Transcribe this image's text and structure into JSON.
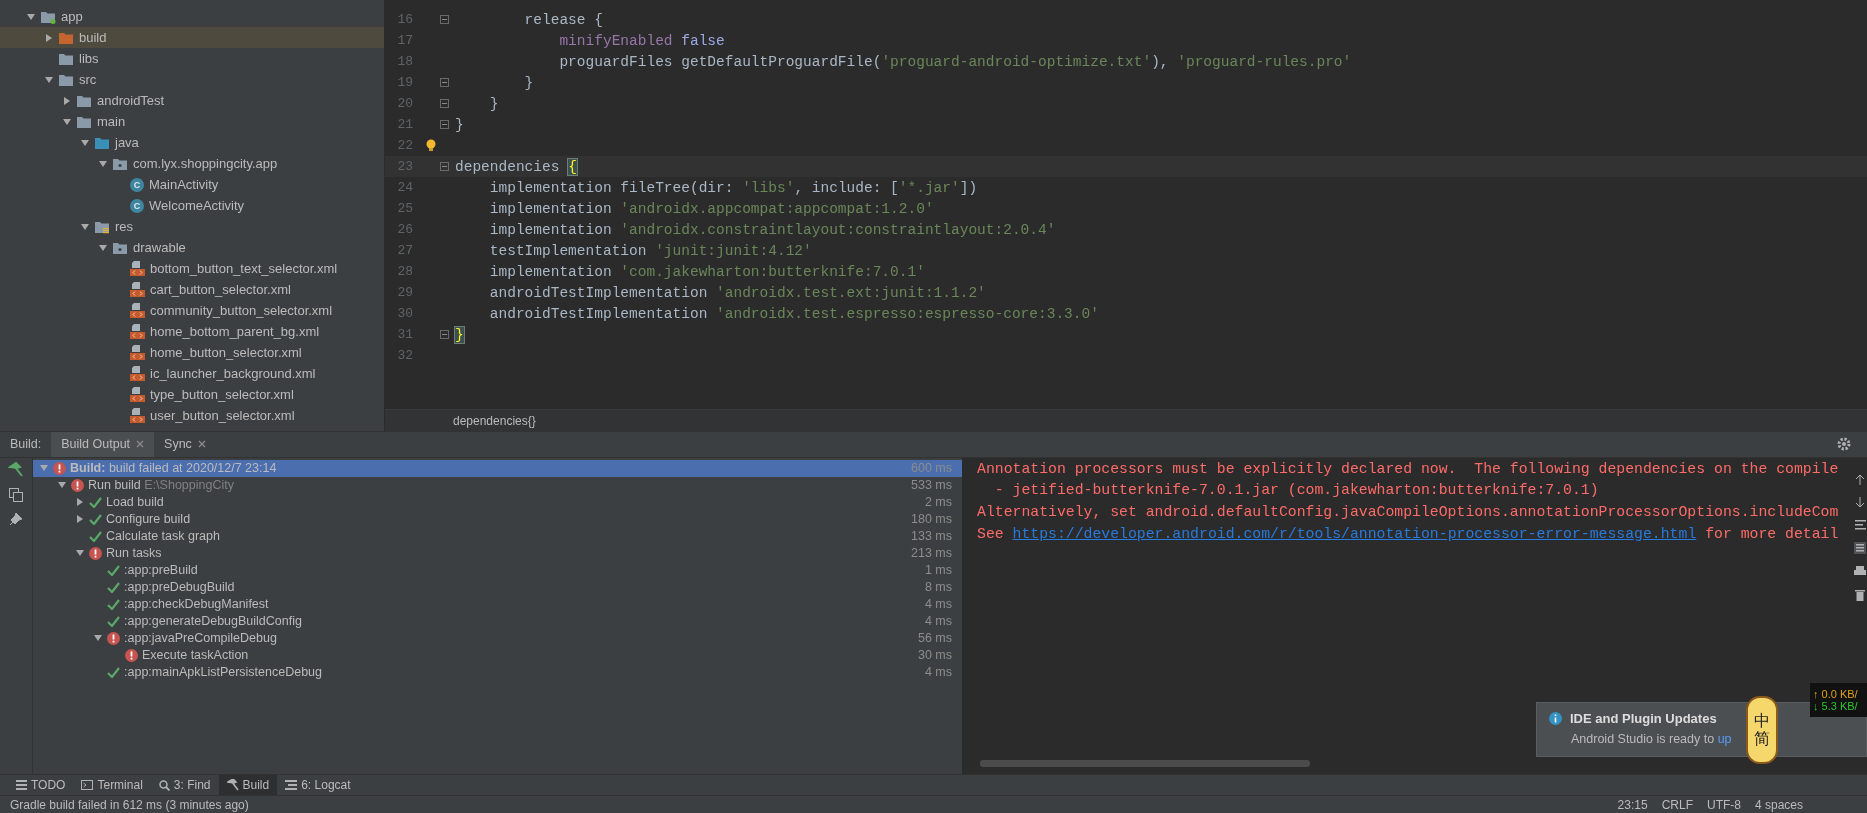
{
  "project_tree": [
    {
      "label": "app",
      "kind": "module",
      "expanded": true,
      "selected": false,
      "children": [
        {
          "label": "build",
          "kind": "excluded_folder",
          "expanded": false,
          "selected": true
        },
        {
          "label": "libs",
          "kind": "folder",
          "selected": false
        },
        {
          "label": "src",
          "kind": "folder",
          "expanded": true,
          "selected": false,
          "children": [
            {
              "label": "androidTest",
              "kind": "folder",
              "expanded": false,
              "selected": false
            },
            {
              "label": "main",
              "kind": "folder",
              "expanded": true,
              "selected": false,
              "children": [
                {
                  "label": "java",
                  "kind": "source_folder",
                  "expanded": true,
                  "selected": false,
                  "children": [
                    {
                      "label": "com.lyx.shoppingcity.app",
                      "kind": "package",
                      "expanded": true,
                      "selected": false,
                      "children": [
                        {
                          "label": "MainActivity",
                          "kind": "class",
                          "icon_letter": "C",
                          "selected": false
                        },
                        {
                          "label": "WelcomeActivity",
                          "kind": "class",
                          "icon_letter": "C",
                          "selected": false
                        }
                      ]
                    }
                  ]
                },
                {
                  "label": "res",
                  "kind": "res_folder",
                  "expanded": true,
                  "selected": false,
                  "children": [
                    {
                      "label": "drawable",
                      "kind": "package",
                      "expanded": true,
                      "selected": false,
                      "children": [
                        {
                          "label": "bottom_button_text_selector.xml",
                          "kind": "xml",
                          "selected": false
                        },
                        {
                          "label": "cart_button_selector.xml",
                          "kind": "xml",
                          "selected": false
                        },
                        {
                          "label": "community_button_selector.xml",
                          "kind": "xml",
                          "selected": false
                        },
                        {
                          "label": "home_bottom_parent_bg.xml",
                          "kind": "xml",
                          "selected": false
                        },
                        {
                          "label": "home_button_selector.xml",
                          "kind": "xml",
                          "selected": false
                        },
                        {
                          "label": "ic_launcher_background.xml",
                          "kind": "xml",
                          "selected": false
                        },
                        {
                          "label": "type_button_selector.xml",
                          "kind": "xml",
                          "selected": false
                        },
                        {
                          "label": "user_button_selector.xml",
                          "kind": "xml",
                          "selected": false
                        }
                      ]
                    }
                  ]
                }
              ]
            }
          ]
        }
      ]
    }
  ],
  "editor": {
    "lines": [
      {
        "number": "16",
        "fold": true,
        "hint": false,
        "current": false,
        "tokens": [
          {
            "kind": "plain",
            "text": "        release {"
          }
        ]
      },
      {
        "number": "17",
        "fold": false,
        "hint": false,
        "current": false,
        "tokens": [
          {
            "kind": "property",
            "text": "            minifyEnabled"
          },
          {
            "kind": "keyword",
            "text": " false"
          }
        ]
      },
      {
        "number": "18",
        "fold": false,
        "hint": false,
        "current": false,
        "tokens": [
          {
            "kind": "plain",
            "text": "            proguardFiles getDefaultProguardFile("
          },
          {
            "kind": "string",
            "text": "'proguard-android-optimize.txt'"
          },
          {
            "kind": "plain",
            "text": "), "
          },
          {
            "kind": "string",
            "text": "'proguard-rules.pro'"
          }
        ]
      },
      {
        "number": "19",
        "fold": true,
        "hint": false,
        "current": false,
        "tokens": [
          {
            "kind": "plain",
            "text": "        }"
          }
        ]
      },
      {
        "number": "20",
        "fold": true,
        "hint": false,
        "current": false,
        "tokens": [
          {
            "kind": "plain",
            "text": "    }"
          }
        ]
      },
      {
        "number": "21",
        "fold": true,
        "hint": false,
        "current": false,
        "tokens": [
          {
            "kind": "plain",
            "text": "}"
          }
        ]
      },
      {
        "number": "22",
        "fold": false,
        "hint": true,
        "current": false
      },
      {
        "number": "23",
        "fold": true,
        "hint": false,
        "current": true,
        "tokens": [
          {
            "kind": "plain",
            "text": "dependencies "
          },
          {
            "kind": "brace_match",
            "text": "{"
          }
        ]
      },
      {
        "number": "24",
        "fold": false,
        "hint": false,
        "current": false,
        "tokens": [
          {
            "kind": "plain",
            "text": "    implementation fileTree(dir: "
          },
          {
            "kind": "string",
            "text": "'libs'"
          },
          {
            "kind": "plain",
            "text": ", include: ["
          },
          {
            "kind": "string",
            "text": "'*.jar'"
          },
          {
            "kind": "plain",
            "text": "])"
          }
        ]
      },
      {
        "number": "25",
        "fold": false,
        "hint": false,
        "current": false,
        "tokens": [
          {
            "kind": "plain",
            "text": "    implementation "
          },
          {
            "kind": "string",
            "text": "'androidx.appcompat:appcompat:1.2.0'"
          }
        ]
      },
      {
        "number": "26",
        "fold": false,
        "hint": false,
        "current": false,
        "tokens": [
          {
            "kind": "plain",
            "text": "    implementation "
          },
          {
            "kind": "string",
            "text": "'androidx.constraintlayout:constraintlayout:2.0.4'"
          }
        ]
      },
      {
        "number": "27",
        "fold": false,
        "hint": false,
        "current": false,
        "tokens": [
          {
            "kind": "plain",
            "text": "    testImplementation "
          },
          {
            "kind": "string",
            "text": "'junit:junit:4.12'"
          }
        ]
      },
      {
        "number": "28",
        "fold": false,
        "hint": false,
        "current": false,
        "tokens": [
          {
            "kind": "plain",
            "text": "    implementation "
          },
          {
            "kind": "string",
            "text": "'com.jakewharton:butterknife:7.0.1'"
          }
        ]
      },
      {
        "number": "29",
        "fold": false,
        "hint": false,
        "current": false,
        "tokens": [
          {
            "kind": "plain",
            "text": "    androidTestImplementation "
          },
          {
            "kind": "string",
            "text": "'androidx.test.ext:junit:1.1.2'"
          }
        ]
      },
      {
        "number": "30",
        "fold": false,
        "hint": false,
        "current": false,
        "tokens": [
          {
            "kind": "plain",
            "text": "    androidTestImplementation "
          },
          {
            "kind": "string",
            "text": "'androidx.test.espresso:espresso-core:3.3.0'"
          }
        ]
      },
      {
        "number": "31",
        "fold": true,
        "hint": false,
        "current": false,
        "tokens": [
          {
            "kind": "brace_match",
            "text": "}"
          }
        ]
      },
      {
        "number": "32",
        "fold": false,
        "hint": false,
        "current": false
      }
    ],
    "breadcrumb": "dependencies{}"
  },
  "build_panel": {
    "label": "Build:",
    "tabs": [
      {
        "label": "Build Output",
        "selected": true
      },
      {
        "label": "Sync",
        "selected": false
      }
    ],
    "tree": [
      {
        "text": "**Build:** build failed at 2020/12/7 23:14",
        "kind": "error",
        "expanded": true,
        "selected": true,
        "time": "600 ms",
        "children": [
          {
            "text": "Run build",
            "detail": "E:\\ShoppingCity",
            "kind": "error",
            "expanded": true,
            "selected": false,
            "time": "533 ms",
            "children": [
              {
                "text": "Load build",
                "kind": "ok",
                "expanded": false,
                "selected": false,
                "time": "2 ms"
              },
              {
                "text": "Configure build",
                "kind": "ok",
                "expanded": false,
                "selected": false,
                "time": "180 ms"
              },
              {
                "text": "Calculate task graph",
                "kind": "ok",
                "selected": false,
                "time": "133 ms"
              },
              {
                "text": "Run tasks",
                "kind": "error",
                "expanded": true,
                "selected": false,
                "time": "213 ms",
                "children": [
                  {
                    "text": ":app:preBuild",
                    "kind": "ok",
                    "selected": false,
                    "time": "1 ms"
                  },
                  {
                    "text": ":app:preDebugBuild",
                    "kind": "ok",
                    "selected": false,
                    "time": "8 ms"
                  },
                  {
                    "text": ":app:checkDebugManifest",
                    "kind": "ok",
                    "selected": false,
                    "time": "4 ms"
                  },
                  {
                    "text": ":app:generateDebugBuildConfig",
                    "kind": "ok",
                    "selected": false,
                    "time": "4 ms"
                  },
                  {
                    "text": ":app:javaPreCompileDebug",
                    "kind": "error",
                    "expanded": true,
                    "selected": false,
                    "time": "56 ms",
                    "children": [
                      {
                        "text": "Execute taskAction",
                        "kind": "error",
                        "selected": false,
                        "time": "30 ms"
                      }
                    ]
                  },
                  {
                    "text": ":app:mainApkListPersistenceDebug",
                    "kind": "ok",
                    "selected": false,
                    "time": "4 ms"
                  }
                ]
              }
            ]
          }
        ]
      }
    ],
    "console": [
      [
        {
          "kind": "text",
          "text": "Annotation processors must be explicitly declared now.  The following dependencies on the compile"
        }
      ],
      [
        {
          "kind": "text",
          "text": "  - jetified-butterknife-7.0.1.jar (com.jakewharton:butterknife:7.0.1)"
        }
      ],
      [
        {
          "kind": "text",
          "text": "Alternatively, set android.defaultConfig.javaCompileOptions.annotationProcessorOptions.includeCom"
        }
      ],
      [
        {
          "kind": "text",
          "text": "See "
        },
        {
          "kind": "link",
          "text": "https://developer.android.com/r/tools/annotation-processor-error-message.html"
        },
        {
          "kind": "text",
          "text": " for more detail"
        }
      ]
    ]
  },
  "tool_windows": [
    {
      "label": "TODO",
      "selected": false
    },
    {
      "label": "Terminal",
      "selected": false
    },
    {
      "label": "3: Find",
      "selected": false
    },
    {
      "label": "Build",
      "selected": true
    },
    {
      "label": "6: Logcat",
      "selected": false
    }
  ],
  "status_bar": {
    "message": "Gradle build failed in 612 ms (3 minutes ago)",
    "items": [
      "23:15",
      "CRLF",
      "UTF-8",
      "4 spaces"
    ]
  },
  "notification": {
    "title": "IDE and Plugin Updates",
    "body": "Android Studio is ready to ",
    "link": "up"
  },
  "network_monitor": {
    "upload": "↑ 0.0 KB/",
    "download": "↓ 5.3 KB/"
  },
  "ime_widget": {
    "labels": [
      "中",
      "简"
    ]
  }
}
